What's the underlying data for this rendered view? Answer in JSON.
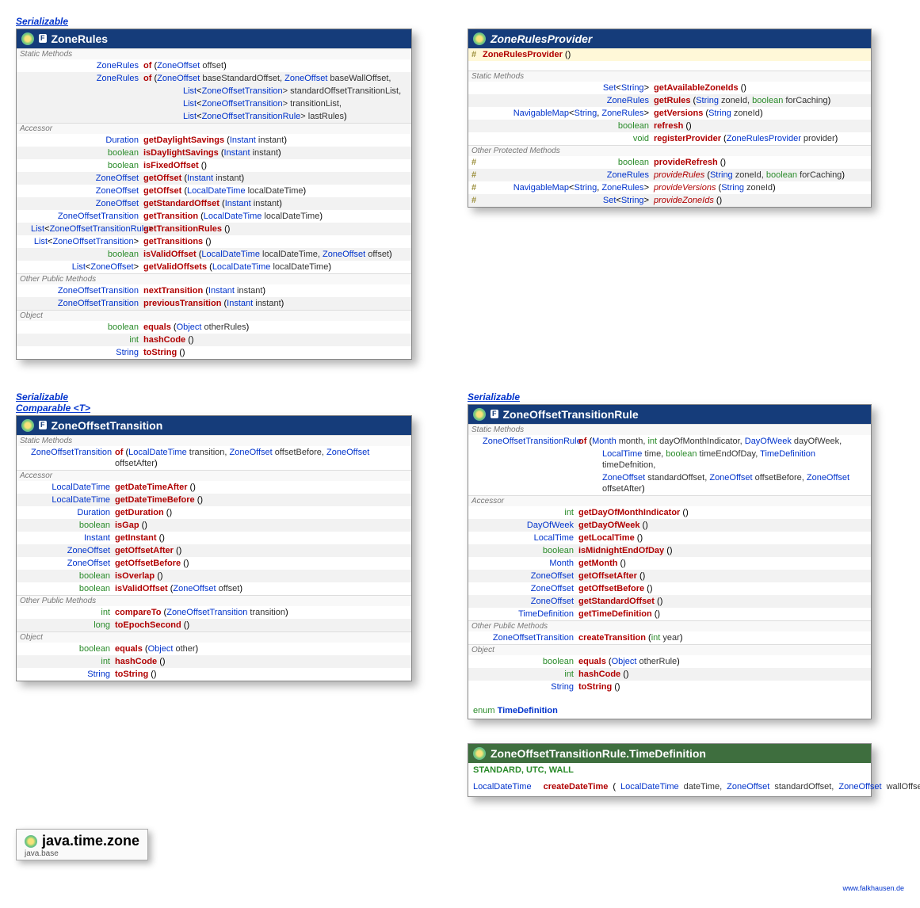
{
  "footer": "www.falkhausen.de",
  "package": {
    "name": "java.time.zone",
    "module": "java.base"
  },
  "interfaces": {
    "serializable": "Serializable",
    "comparable": "Comparable <T>"
  },
  "zoneRules": {
    "title": "ZoneRules",
    "sections": {
      "static": "Static Methods",
      "accessor": "Accessor",
      "other": "Other Public Methods",
      "object": "Object"
    },
    "of1": {
      "ret": "ZoneRules",
      "name": "of",
      "p1": "ZoneOffset",
      "p1n": " offset"
    },
    "of2": {
      "ret": "ZoneRules",
      "name": "of",
      "l1a": "ZoneOffset",
      "l1b": " baseStandardOffset, ",
      "l1c": "ZoneOffset",
      "l1d": " baseWallOffset,",
      "l2a": "List",
      "l2b": "<",
      "l2c": "ZoneOffsetTransition",
      "l2d": "> standardOffsetTransitionList,",
      "l3a": "List",
      "l3b": "<",
      "l3c": "ZoneOffsetTransition",
      "l3d": "> transitionList,",
      "l4a": "List",
      "l4b": "<",
      "l4c": "ZoneOffsetTransitionRule",
      "l4d": "> lastRules"
    },
    "getDaylight": {
      "ret": "Duration",
      "name": "getDaylightSavings",
      "p1": "Instant",
      "p1n": " instant"
    },
    "isDaylight": {
      "ret": "boolean",
      "name": "isDaylightSavings",
      "p1": "Instant",
      "p1n": " instant"
    },
    "isFixed": {
      "ret": "boolean",
      "name": "isFixedOffset"
    },
    "getOffset1": {
      "ret": "ZoneOffset",
      "name": "getOffset",
      "p1": "Instant",
      "p1n": " instant"
    },
    "getOffset2": {
      "ret": "ZoneOffset",
      "name": "getOffset",
      "p1": "LocalDateTime",
      "p1n": " localDateTime"
    },
    "getStd": {
      "ret": "ZoneOffset",
      "name": "getStandardOffset",
      "p1": "Instant",
      "p1n": " instant"
    },
    "getTrans": {
      "ret": "ZoneOffsetTransition",
      "name": "getTransition",
      "p1": "LocalDateTime",
      "p1n": " localDateTime"
    },
    "getTransRules": {
      "ret1": "List",
      "ret2": "ZoneOffsetTransitionRule",
      "name": "getTransitionRules"
    },
    "getTransitions": {
      "ret1": "List",
      "ret2": "ZoneOffsetTransition",
      "name": "getTransitions"
    },
    "isValid": {
      "ret": "boolean",
      "name": "isValidOffset",
      "p1": "LocalDateTime",
      "p1n": " localDateTime, ",
      "p2": "ZoneOffset",
      "p2n": " offset"
    },
    "getValid": {
      "ret1": "List",
      "ret2": "ZoneOffset",
      "name": "getValidOffsets",
      "p1": "LocalDateTime",
      "p1n": " localDateTime"
    },
    "next": {
      "ret": "ZoneOffsetTransition",
      "name": "nextTransition",
      "p1": "Instant",
      "p1n": " instant"
    },
    "prev": {
      "ret": "ZoneOffsetTransition",
      "name": "previousTransition",
      "p1": "Instant",
      "p1n": " instant"
    },
    "equals": {
      "ret": "boolean",
      "name": "equals",
      "p1": "Object",
      "p1n": " otherRules"
    },
    "hash": {
      "ret": "int",
      "name": "hashCode"
    },
    "toStr": {
      "ret": "String",
      "name": "toString"
    }
  },
  "provider": {
    "title": "ZoneRulesProvider",
    "ctor": "ZoneRulesProvider",
    "sections": {
      "static": "Static Methods",
      "other": "Other Protected Methods"
    },
    "avail": {
      "ret1": "Set",
      "ret2": "String",
      "name": "getAvailableZoneIds"
    },
    "getRules": {
      "ret": "ZoneRules",
      "name": "getRules",
      "p1": "String",
      "p1n": " zoneId, ",
      "p2": "boolean",
      "p2n": " forCaching"
    },
    "getVer": {
      "ret1": "NavigableMap",
      "ret2": "String",
      "ret3": "ZoneRules",
      "name": "getVersions",
      "p1": "String",
      "p1n": " zoneId"
    },
    "refresh": {
      "ret": "boolean",
      "name": "refresh"
    },
    "register": {
      "ret": "void",
      "name": "registerProvider",
      "p1": "ZoneRulesProvider",
      "p1n": " provider"
    },
    "pRefresh": {
      "ret": "boolean",
      "name": "provideRefresh"
    },
    "pRules": {
      "ret": "ZoneRules",
      "name": "provideRules",
      "p1": "String",
      "p1n": " zoneId, ",
      "p2": "boolean",
      "p2n": " forCaching"
    },
    "pVer": {
      "ret1": "NavigableMap",
      "ret2": "String",
      "ret3": "ZoneRules",
      "name": "provideVersions",
      "p1": "String",
      "p1n": " zoneId"
    },
    "pIds": {
      "ret1": "Set",
      "ret2": "String",
      "name": "provideZoneIds"
    }
  },
  "zot": {
    "title": "ZoneOffsetTransition",
    "sections": {
      "static": "Static Methods",
      "accessor": "Accessor",
      "other": "Other Public Methods",
      "object": "Object"
    },
    "of": {
      "ret": "ZoneOffsetTransition",
      "name": "of",
      "p1": "LocalDateTime",
      "p1n": " transition, ",
      "p2": "ZoneOffset",
      "p2n": " offsetBefore, ",
      "p3": "ZoneOffset",
      "p3n": " offsetAfter"
    },
    "dta": {
      "ret": "LocalDateTime",
      "name": "getDateTimeAfter"
    },
    "dtb": {
      "ret": "LocalDateTime",
      "name": "getDateTimeBefore"
    },
    "dur": {
      "ret": "Duration",
      "name": "getDuration"
    },
    "gap": {
      "ret": "boolean",
      "name": "isGap"
    },
    "inst": {
      "ret": "Instant",
      "name": "getInstant"
    },
    "oa": {
      "ret": "ZoneOffset",
      "name": "getOffsetAfter"
    },
    "ob": {
      "ret": "ZoneOffset",
      "name": "getOffsetBefore"
    },
    "ov": {
      "ret": "boolean",
      "name": "isOverlap"
    },
    "iv": {
      "ret": "boolean",
      "name": "isValidOffset",
      "p1": "ZoneOffset",
      "p1n": " offset"
    },
    "cmp": {
      "ret": "int",
      "name": "compareTo",
      "p1": "ZoneOffsetTransition",
      "p1n": " transition"
    },
    "epoch": {
      "ret": "long",
      "name": "toEpochSecond"
    },
    "equals": {
      "ret": "boolean",
      "name": "equals",
      "p1": "Object",
      "p1n": " other"
    },
    "hash": {
      "ret": "int",
      "name": "hashCode"
    },
    "toStr": {
      "ret": "String",
      "name": "toString"
    }
  },
  "zotr": {
    "title": "ZoneOffsetTransitionRule",
    "sections": {
      "static": "Static Methods",
      "accessor": "Accessor",
      "other": "Other Public Methods",
      "object": "Object"
    },
    "of": {
      "ret": "ZoneOffsetTransitionRule",
      "name": "of",
      "l1a": "Month",
      "l1b": " month, ",
      "l1c": "int",
      "l1d": " dayOfMonthIndicator, ",
      "l1e": "DayOfWeek",
      "l1f": " dayOfWeek,",
      "l2a": "LocalTime",
      "l2b": " time, ",
      "l2c": "boolean",
      "l2d": " timeEndOfDay, ",
      "l2e": "TimeDefinition",
      "l2f": " timeDefnition,",
      "l3a": "ZoneOffset",
      "l3b": " standardOffset, ",
      "l3c": "ZoneOffset",
      "l3d": " offsetBefore, ",
      "l3e": "ZoneOffset",
      "l3f": " offsetAfter"
    },
    "domi": {
      "ret": "int",
      "name": "getDayOfMonthIndicator"
    },
    "dow": {
      "ret": "DayOfWeek",
      "name": "getDayOfWeek"
    },
    "lt": {
      "ret": "LocalTime",
      "name": "getLocalTime"
    },
    "mid": {
      "ret": "boolean",
      "name": "isMidnightEndOfDay"
    },
    "month": {
      "ret": "Month",
      "name": "getMonth"
    },
    "oa": {
      "ret": "ZoneOffset",
      "name": "getOffsetAfter"
    },
    "ob": {
      "ret": "ZoneOffset",
      "name": "getOffsetBefore"
    },
    "std": {
      "ret": "ZoneOffset",
      "name": "getStandardOffset"
    },
    "td": {
      "ret": "TimeDefinition",
      "name": "getTimeDefinition"
    },
    "ct": {
      "ret": "ZoneOffsetTransition",
      "name": "createTransition",
      "p1": "int",
      "p1n": " year"
    },
    "equals": {
      "ret": "boolean",
      "name": "equals",
      "p1": "Object",
      "p1n": " otherRule"
    },
    "hash": {
      "ret": "int",
      "name": "hashCode"
    },
    "toStr": {
      "ret": "String",
      "name": "toString"
    },
    "nested": {
      "kw": "enum",
      "name": "TimeDefinition"
    }
  },
  "timeDef": {
    "title": "ZoneOffsetTransitionRule.TimeDefinition",
    "values": "STANDARD, UTC, WALL",
    "cdt": {
      "ret": "LocalDateTime",
      "name": "createDateTime",
      "p1": "LocalDateTime",
      "p1n": " dateTime, ",
      "p2": "ZoneOffset",
      "p2n": " standardOffset, ",
      "p3": "ZoneOffset",
      "p3n": " wallOffset"
    }
  }
}
